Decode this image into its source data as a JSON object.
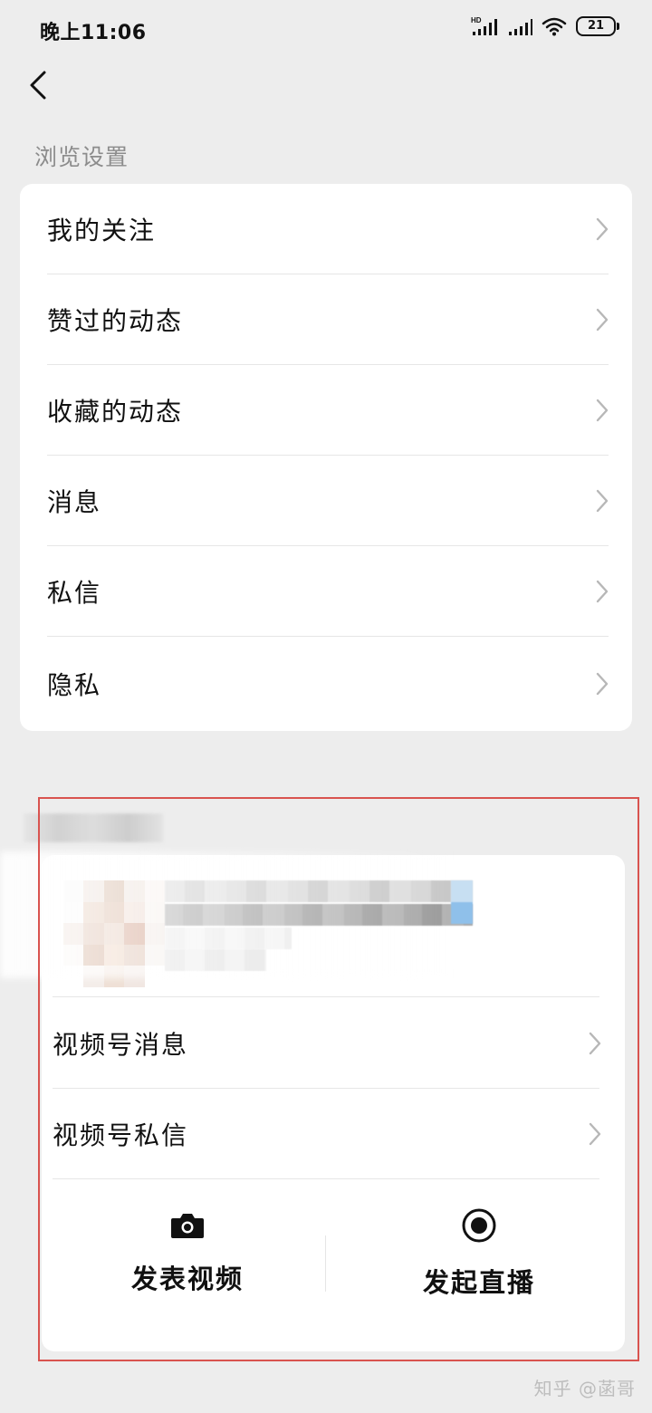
{
  "status_bar": {
    "time": "晚上11:06",
    "network_badge": "HD",
    "battery": "21"
  },
  "section": {
    "title": "浏览设置"
  },
  "menu": [
    {
      "label": "我的关注"
    },
    {
      "label": "赞过的动态"
    },
    {
      "label": "收藏的动态"
    },
    {
      "label": "消息"
    },
    {
      "label": "私信"
    },
    {
      "label": "隐私"
    }
  ],
  "channel": {
    "items": [
      {
        "label": "视频号消息"
      },
      {
        "label": "视频号私信"
      }
    ],
    "actions": {
      "post_video": "发表视频",
      "start_live": "发起直播"
    }
  },
  "watermark": "知乎 @菡哥",
  "colors": {
    "background": "#ededed",
    "card": "#ffffff",
    "text": "#111111",
    "muted": "#8c8c8c",
    "highlight_frame": "#d9534f"
  },
  "icons": {
    "back": "back-chevron-icon",
    "row": "chevron-right-icon",
    "camera": "camera-icon",
    "record": "record-icon",
    "signal": "signal-icon",
    "wifi": "wifi-icon",
    "battery": "battery-icon"
  }
}
